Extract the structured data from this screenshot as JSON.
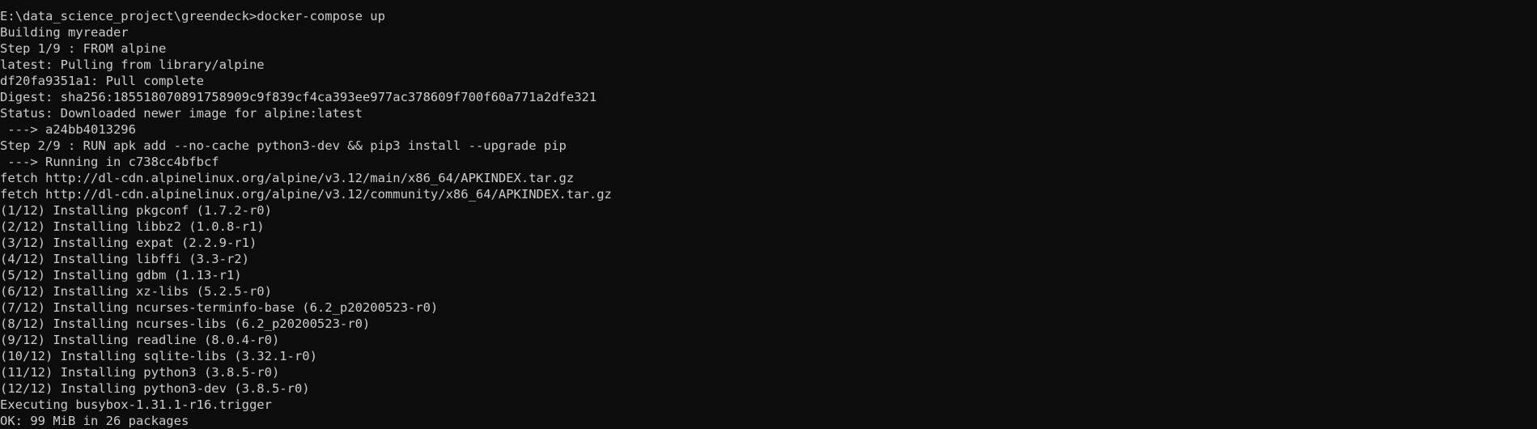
{
  "terminal": {
    "lines": [
      "E:\\data_science_project\\greendeck>docker-compose up",
      "Building myreader",
      "Step 1/9 : FROM alpine",
      "latest: Pulling from library/alpine",
      "df20fa9351a1: Pull complete",
      "Digest: sha256:185518070891758909c9f839cf4ca393ee977ac378609f700f60a771a2dfe321",
      "Status: Downloaded newer image for alpine:latest",
      " ---> a24bb4013296",
      "Step 2/9 : RUN apk add --no-cache python3-dev && pip3 install --upgrade pip",
      " ---> Running in c738cc4bfbcf",
      "fetch http://dl-cdn.alpinelinux.org/alpine/v3.12/main/x86_64/APKINDEX.tar.gz",
      "fetch http://dl-cdn.alpinelinux.org/alpine/v3.12/community/x86_64/APKINDEX.tar.gz",
      "(1/12) Installing pkgconf (1.7.2-r0)",
      "(2/12) Installing libbz2 (1.0.8-r1)",
      "(3/12) Installing expat (2.2.9-r1)",
      "(4/12) Installing libffi (3.3-r2)",
      "(5/12) Installing gdbm (1.13-r1)",
      "(6/12) Installing xz-libs (5.2.5-r0)",
      "(7/12) Installing ncurses-terminfo-base (6.2_p20200523-r0)",
      "(8/12) Installing ncurses-libs (6.2_p20200523-r0)",
      "(9/12) Installing readline (8.0.4-r0)",
      "(10/12) Installing sqlite-libs (3.32.1-r0)",
      "(11/12) Installing python3 (3.8.5-r0)",
      "(12/12) Installing python3-dev (3.8.5-r0)",
      "Executing busybox-1.31.1-r16.trigger",
      "OK: 99 MiB in 26 packages"
    ]
  }
}
